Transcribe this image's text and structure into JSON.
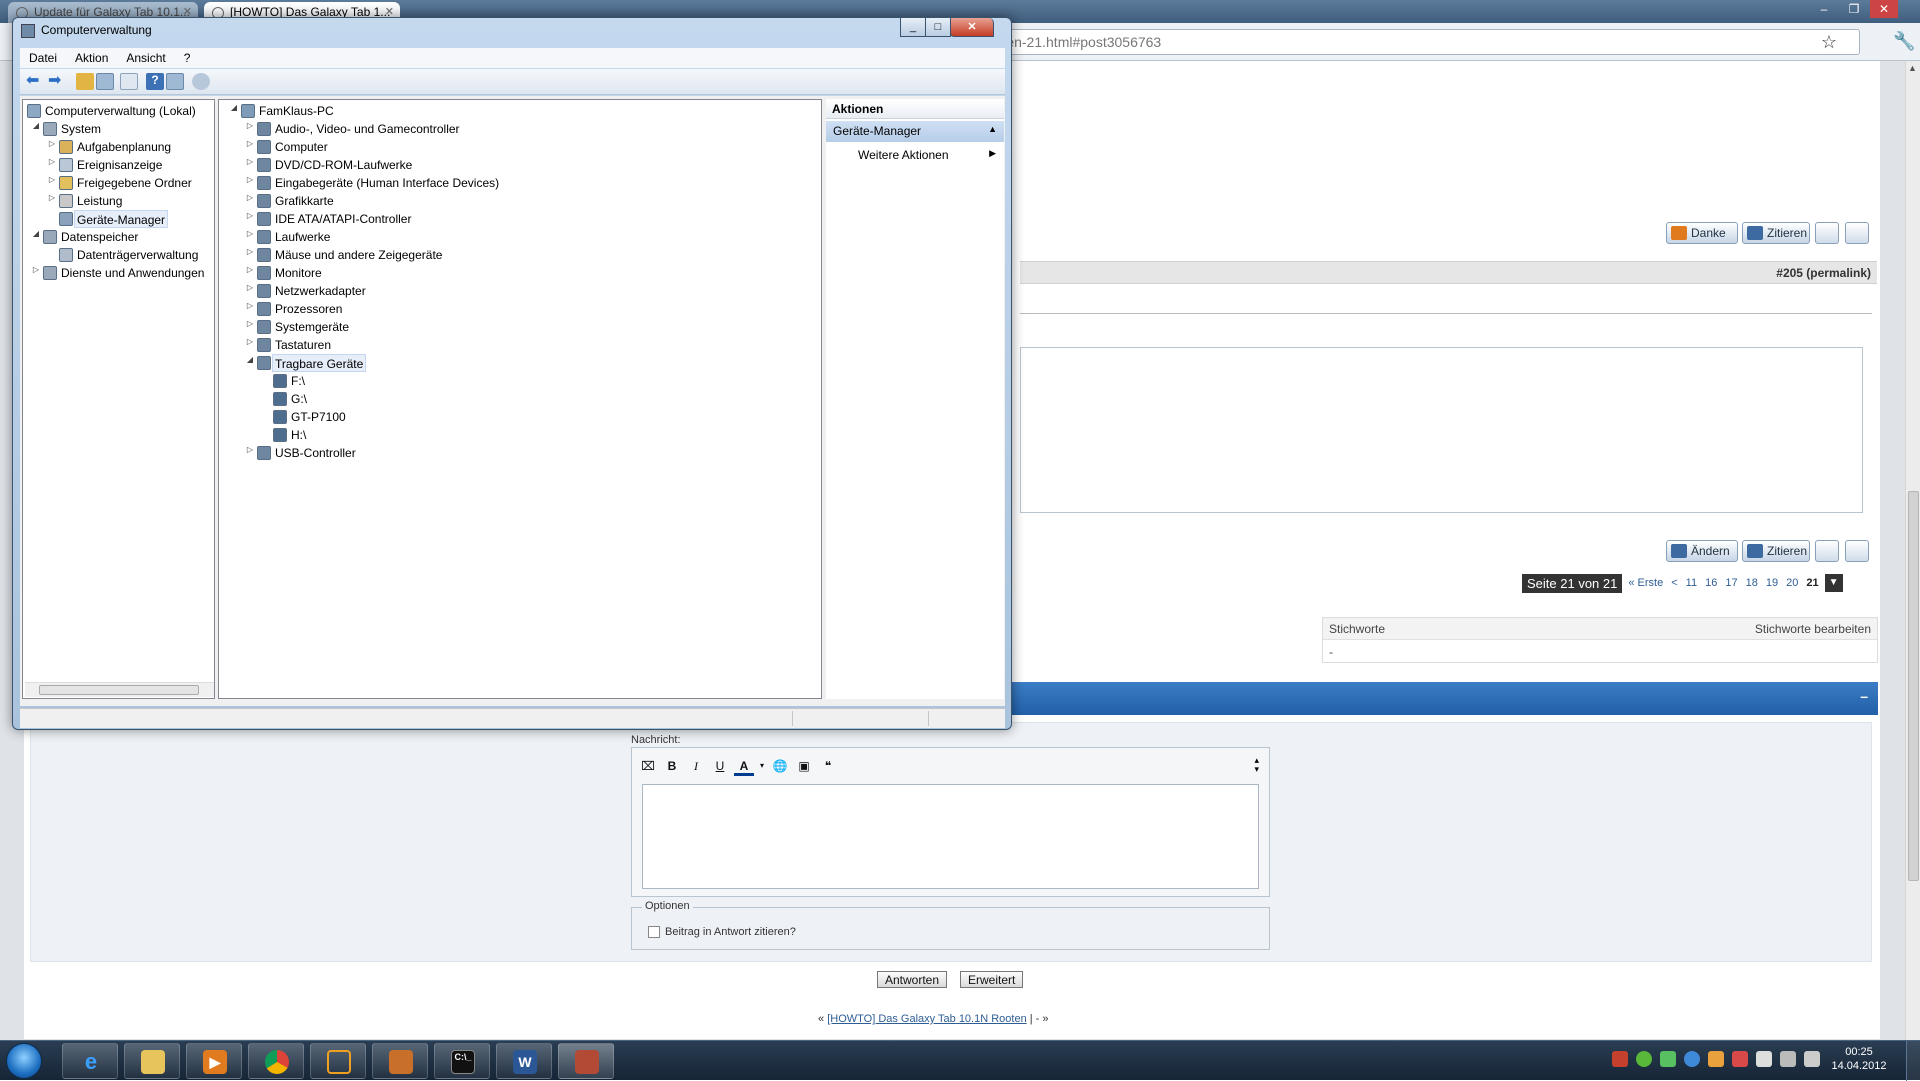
{
  "browser": {
    "tabs": [
      {
        "title": "Update für Galaxy Tab 10.1..."
      },
      {
        "title": "[HOWTO] Das Galaxy Tab 1..."
      }
    ],
    "url_fragment": "rren-21.html#post3056763",
    "post_actions_top": {
      "thanks": "Danke",
      "quote": "Zitieren"
    },
    "post_actions_bottom": {
      "edit": "Ändern",
      "quote": "Zitieren"
    },
    "post_number": "#205 (permalink)",
    "pagination": {
      "current": "Seite 21 von 21",
      "first": "« Erste",
      "prev": "<",
      "pages": [
        "11",
        "16",
        "17",
        "18",
        "19",
        "20",
        "21"
      ],
      "active": "21"
    },
    "tags": {
      "header": "Stichworte",
      "edit": "Stichworte bearbeiten",
      "value": "-"
    },
    "reply": {
      "collapse": "–",
      "message_label": "Nachricht:",
      "editor_buttons": [
        "B",
        "I",
        "U",
        "A"
      ],
      "options_legend": "Optionen",
      "quote_checkbox": "Beitrag in Antwort zitieren?",
      "submit": "Antworten",
      "advanced": "Erweitert"
    },
    "bottom_nav": {
      "prefix": "«",
      "link": "[HOWTO] Das Galaxy Tab 10.1N Rooten",
      "suffix": "| - »"
    }
  },
  "window": {
    "title": "Computerverwaltung",
    "menu": [
      "Datei",
      "Aktion",
      "Ansicht",
      "?"
    ],
    "left_tree": [
      {
        "label": "Computerverwaltung (Lokal)",
        "level": 0,
        "toggle": ""
      },
      {
        "label": "System",
        "level": 1,
        "toggle": "◢"
      },
      {
        "label": "Aufgabenplanung",
        "level": 2,
        "toggle": "▷"
      },
      {
        "label": "Ereignisanzeige",
        "level": 2,
        "toggle": "▷"
      },
      {
        "label": "Freigegebene Ordner",
        "level": 2,
        "toggle": "▷"
      },
      {
        "label": "Leistung",
        "level": 2,
        "toggle": "▷"
      },
      {
        "label": "Geräte-Manager",
        "level": 2,
        "toggle": "",
        "selected": true
      },
      {
        "label": "Datenspeicher",
        "level": 1,
        "toggle": "◢"
      },
      {
        "label": "Datenträgerverwaltung",
        "level": 2,
        "toggle": ""
      },
      {
        "label": "Dienste und Anwendungen",
        "level": 1,
        "toggle": "▷"
      }
    ],
    "device_tree": [
      {
        "label": "FamKlaus-PC",
        "level": 0,
        "toggle": "◢"
      },
      {
        "label": "Audio-, Video- und Gamecontroller",
        "level": 1,
        "toggle": "▷"
      },
      {
        "label": "Computer",
        "level": 1,
        "toggle": "▷"
      },
      {
        "label": "DVD/CD-ROM-Laufwerke",
        "level": 1,
        "toggle": "▷"
      },
      {
        "label": "Eingabegeräte (Human Interface Devices)",
        "level": 1,
        "toggle": "▷"
      },
      {
        "label": "Grafikkarte",
        "level": 1,
        "toggle": "▷"
      },
      {
        "label": "IDE ATA/ATAPI-Controller",
        "level": 1,
        "toggle": "▷"
      },
      {
        "label": "Laufwerke",
        "level": 1,
        "toggle": "▷"
      },
      {
        "label": "Mäuse und andere Zeigegeräte",
        "level": 1,
        "toggle": "▷"
      },
      {
        "label": "Monitore",
        "level": 1,
        "toggle": "▷"
      },
      {
        "label": "Netzwerkadapter",
        "level": 1,
        "toggle": "▷"
      },
      {
        "label": "Prozessoren",
        "level": 1,
        "toggle": "▷"
      },
      {
        "label": "Systemgeräte",
        "level": 1,
        "toggle": "▷"
      },
      {
        "label": "Tastaturen",
        "level": 1,
        "toggle": "▷"
      },
      {
        "label": "Tragbare Geräte",
        "level": 1,
        "toggle": "◢",
        "selected": true
      },
      {
        "label": "F:\\",
        "level": 2,
        "toggle": ""
      },
      {
        "label": "G:\\",
        "level": 2,
        "toggle": ""
      },
      {
        "label": "GT-P7100",
        "level": 2,
        "toggle": ""
      },
      {
        "label": "H:\\",
        "level": 2,
        "toggle": ""
      },
      {
        "label": "USB-Controller",
        "level": 1,
        "toggle": "▷"
      }
    ],
    "actions": {
      "header": "Aktionen",
      "section": "Geräte-Manager",
      "item": "Weitere Aktionen"
    }
  },
  "taskbar": {
    "clock_time": "00:25",
    "clock_date": "14.04.2012",
    "apps": [
      "internet-explorer",
      "explorer",
      "media-player",
      "chrome",
      "app-5",
      "app-6",
      "command-prompt",
      "word",
      "computer-management"
    ]
  }
}
